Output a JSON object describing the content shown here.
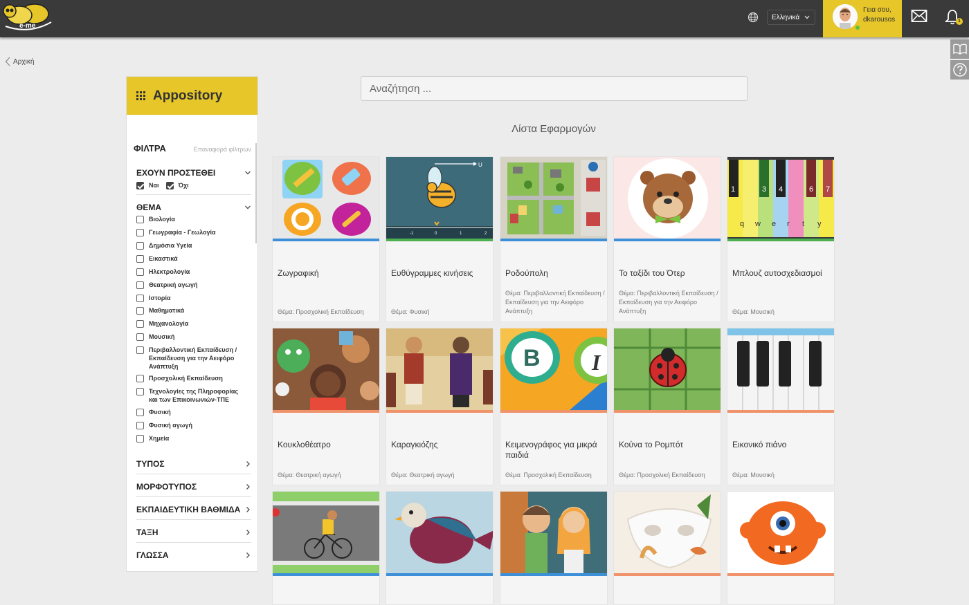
{
  "header": {
    "language": "Ελληνικά",
    "greeting_line1": "Γεια σου,",
    "greeting_line2": "dkarousos",
    "notifications_count": "1",
    "logo_text": "e-me"
  },
  "breadcrumb": {
    "home_label": "Αρχική"
  },
  "sidebar": {
    "title": "Appository",
    "filters_title": "ΦΙΛΤΡΑ",
    "filters_reset": "Επαναφορά φίλτρων",
    "groups": {
      "added": {
        "title": "ΕΧΟΥΝ ΠΡΟΣΤΕΘΕΙ",
        "options": [
          {
            "label": "Ναι",
            "checked": true
          },
          {
            "label": "Όχι",
            "checked": true
          }
        ]
      },
      "theme": {
        "title": "ΘΕΜΑ",
        "options": [
          "Βιολογία",
          "Γεωγραφία - Γεωλογία",
          "Δημόσια Υγεία",
          "Εικαστικά",
          "Ηλεκτρολογία",
          "Θεατρική αγωγή",
          "Ιστορία",
          "Μαθηματικά",
          "Μηχανολογία",
          "Μουσική",
          "Περιβαλλοντική Εκπαίδευση / Εκπαίδευση για την Αειφόρο Ανάπτυξη",
          "Προσχολική Εκπαίδευση",
          "Τεχνολογίες της Πληροφορίας και των Επικοινωνιών-ΤΠΕ",
          "Φυσική",
          "Φυσική αγωγή",
          "Χημεία"
        ]
      },
      "type": {
        "title": "ΤΥΠΟΣ"
      },
      "format": {
        "title": "ΜΟΡΦΟΤΥΠΟΣ"
      },
      "level": {
        "title": "ΕΚΠΑΙΔΕΥΤΙΚΗ ΒΑΘΜΙΔΑ"
      },
      "class": {
        "title": "ΤΑΞΗ"
      },
      "language": {
        "title": "ΓΛΩΣΣΑ"
      }
    }
  },
  "main": {
    "search_placeholder": "Αναζήτηση ...",
    "list_title": "Λίστα Εφαρμογών",
    "apps": [
      {
        "title": "Ζωγραφική",
        "subject": "Θέμα: Προσχολική Εκπαίδευση"
      },
      {
        "title": "Ευθύγραμμες κινήσεις",
        "subject": "Θέμα: Φυσική"
      },
      {
        "title": "Ροδούπολη",
        "subject": "Θέμα: Περιβαλλοντική Εκπαίδευση / Εκπαίδευση για την Αειφόρο Ανάπτυξη"
      },
      {
        "title": "Το ταξίδι του Ότερ",
        "subject": "Θέμα: Περιβαλλοντική Εκπαίδευση / Εκπαίδευση για την Αειφόρο Ανάπτυξη"
      },
      {
        "title": "Μπλουζ αυτοσχεδιασμοί",
        "subject": "Θέμα: Μουσική"
      },
      {
        "title": "Κουκλοθέατρο",
        "subject": "Θέμα: Θεατρική αγωγή"
      },
      {
        "title": "Καραγκιόζης",
        "subject": "Θέμα: Θεατρική αγωγή"
      },
      {
        "title": "Κειμενογράφος για μικρά παιδιά",
        "subject": "Θέμα: Προσχολική Εκπαίδευση"
      },
      {
        "title": "Κούνα το Ρομπότ",
        "subject": "Θέμα: Προσχολική Εκπαίδευση"
      },
      {
        "title": "Εικονικό πιάνο",
        "subject": "Θέμα: Μουσική"
      }
    ]
  },
  "colors": {
    "accent": "#e6c629",
    "topbar": "#3a3a3a",
    "bar_blue": "#3d8fd8",
    "bar_green": "#4caf50",
    "bar_orange": "#f0926a"
  }
}
